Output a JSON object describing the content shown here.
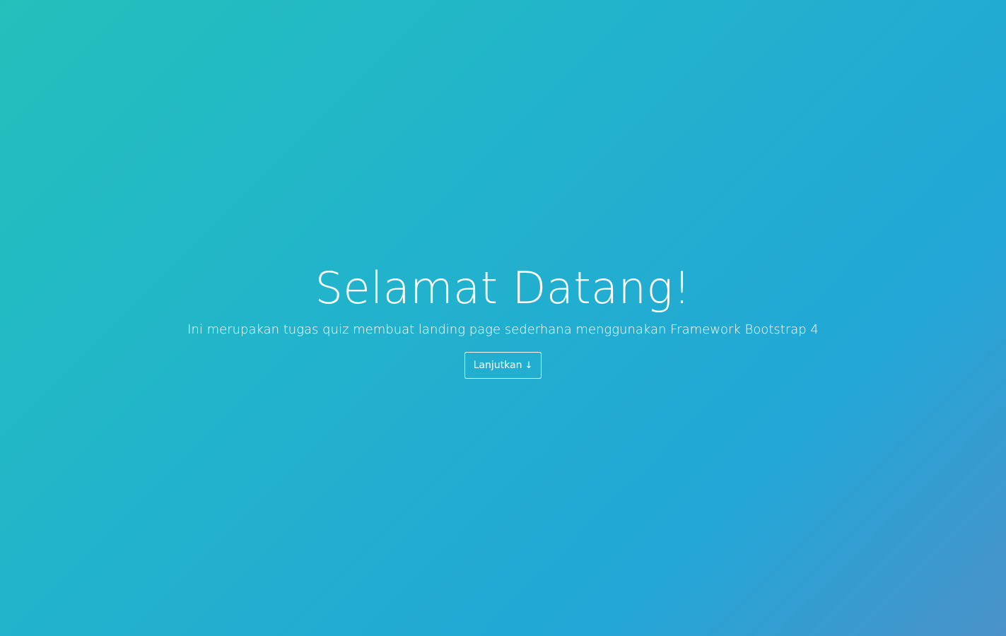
{
  "hero": {
    "title": "Selamat Datang!",
    "subtitle": "Ini merupakan tugas quiz membuat landing page sederhana menggunakan Framework Bootstrap 4",
    "button_label": "Lanjutkan",
    "button_icon": "arrow-down-icon"
  },
  "colors": {
    "gradient_start": "#23c0bb",
    "gradient_end": "#4a92c9",
    "text": "#ffffff"
  }
}
